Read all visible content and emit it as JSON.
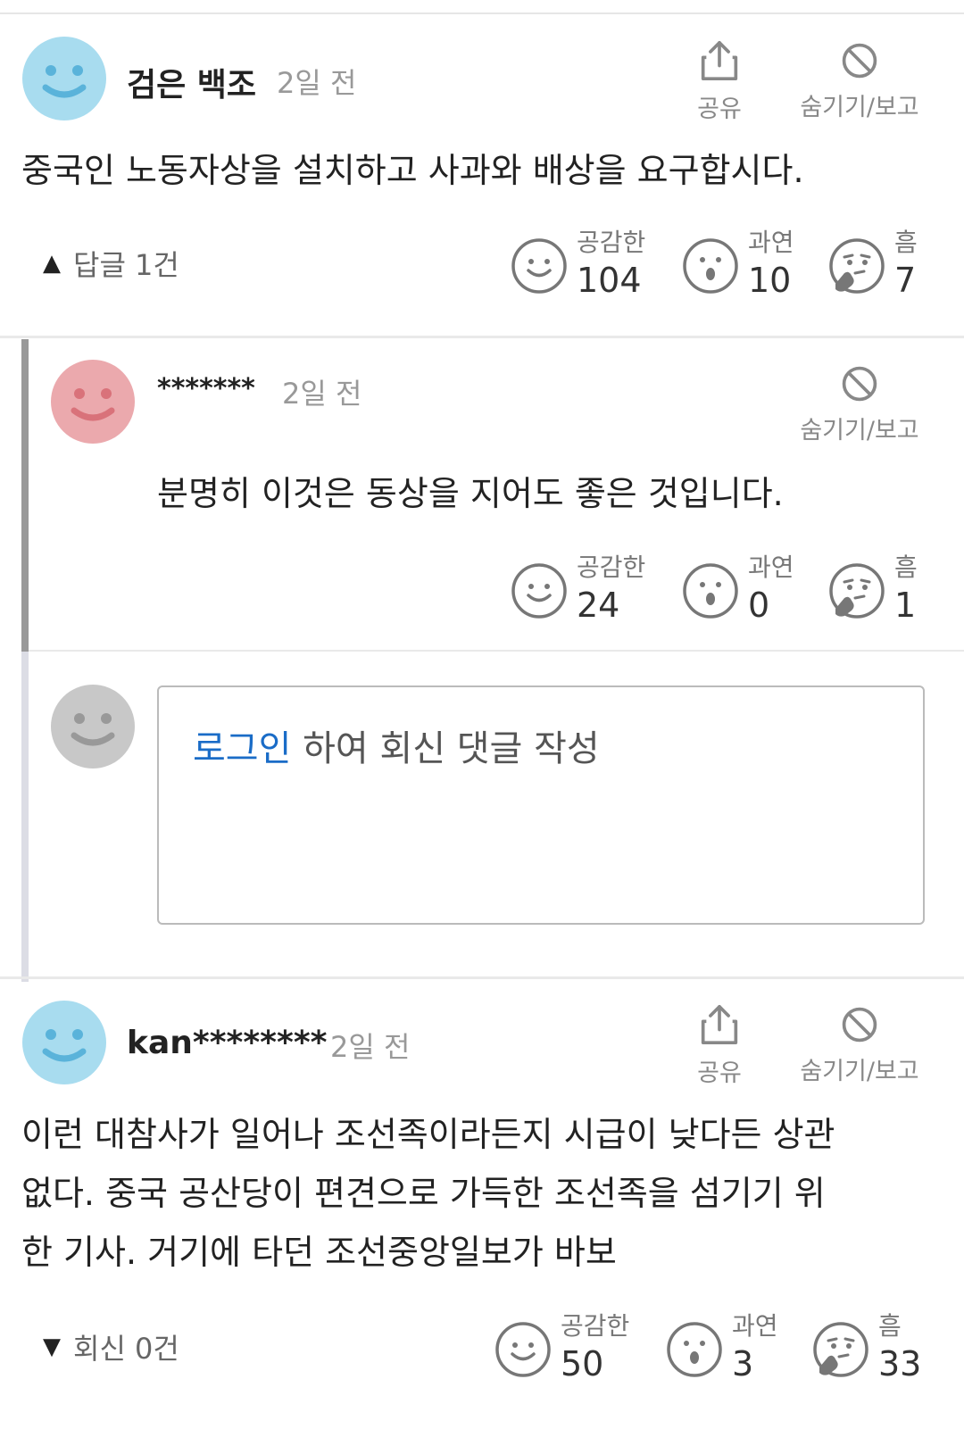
{
  "comments": [
    {
      "username": "검은 백조",
      "time": "2일 전",
      "share_label": "공유",
      "hide_label": "숨기기/보고",
      "text_lines": [
        "중국인 노동자상을 설치하고 사과와 배상을 요구합시다."
      ],
      "replies_toggle": "답글 1건",
      "avatar_color": "#a8dcef",
      "reactions": [
        {
          "label": "공감한",
          "count": "104"
        },
        {
          "label": "과연",
          "count": "10"
        },
        {
          "label": "흠",
          "count": "7"
        }
      ]
    },
    {
      "username": "kan********",
      "time": "2일 전",
      "share_label": "공유",
      "hide_label": "숨기기/보고",
      "text_lines": [
        "이런 대참사가 일어나 조선족이라든지 시급이 낮다든 상관",
        "없다. 중국 공산당이 편견으로 가득한 조선족을 섬기기 위",
        "한 기사. 거기에 타던 조선중앙일보가 바보"
      ],
      "replies_toggle": "회신 0건",
      "avatar_color": "#a8dcef",
      "reactions": [
        {
          "label": "공감한",
          "count": "50"
        },
        {
          "label": "과연",
          "count": "3"
        },
        {
          "label": "흠",
          "count": "33"
        }
      ]
    }
  ],
  "reply": {
    "username": "*******",
    "time": "2일 전",
    "hide_label": "숨기기/보고",
    "text": "분명히 이것은 동상을 지어도 좋은 것입니다.",
    "avatar_color": "#eba9ad",
    "reactions": [
      {
        "label": "공감한",
        "count": "24"
      },
      {
        "label": "과연",
        "count": "0"
      },
      {
        "label": "흠",
        "count": "1"
      }
    ]
  },
  "reply_input": {
    "login_link": "로그인",
    "prompt_rest": " 하여 회신 댓글 작성",
    "avatar_color": "#c8c8c8"
  },
  "colors": {
    "link": "#1a6cc7",
    "reply_bar": "#999999",
    "reply_bar_light": "#dcdde5"
  }
}
